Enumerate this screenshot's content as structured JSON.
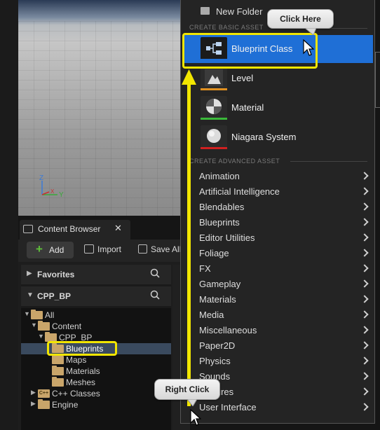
{
  "viewport": {
    "gizmo_z": "Z",
    "gizmo_y": "Y",
    "gizmo_x": "X"
  },
  "content_browser": {
    "tab_label": "Content Browser",
    "tab_close": "✕",
    "toolbar": {
      "add_label": "Add",
      "add_plus": "+",
      "import_label": "Import",
      "saveall_label": "Save All"
    },
    "favorites_label": "Favorites",
    "project_label": "CPP_BP",
    "tree": [
      {
        "label": "All"
      },
      {
        "label": "Content"
      },
      {
        "label": "CPP_BP"
      },
      {
        "label": "Blueprints"
      },
      {
        "label": "Maps"
      },
      {
        "label": "Materials"
      },
      {
        "label": "Meshes"
      },
      {
        "label": "C++ Classes",
        "badge": "C++"
      },
      {
        "label": "Engine"
      }
    ]
  },
  "menu": {
    "new_folder": "New Folder",
    "header_basic": "CREATE BASIC ASSET",
    "header_advanced": "CREATE ADVANCED ASSET",
    "basic_assets": [
      {
        "label": "Blueprint Class",
        "bar_color": "#1f6fd6"
      },
      {
        "label": "Level",
        "bar_color": "#e09020"
      },
      {
        "label": "Material",
        "bar_color": "#3ab83a"
      },
      {
        "label": "Niagara System",
        "bar_color": "#d02020"
      }
    ],
    "advanced_items": [
      "Animation",
      "Artificial Intelligence",
      "Blendables",
      "Blueprints",
      "Editor Utilities",
      "Foliage",
      "FX",
      "Gameplay",
      "Materials",
      "Media",
      "Miscellaneous",
      "Paper2D",
      "Physics",
      "Sounds",
      "Textures",
      "User Interface"
    ]
  },
  "callouts": {
    "click_here": "Click Here",
    "right_click": "Right Click"
  },
  "colors": {
    "highlight_yellow": "#f2e600",
    "selection_blue": "#1f6fd6"
  }
}
